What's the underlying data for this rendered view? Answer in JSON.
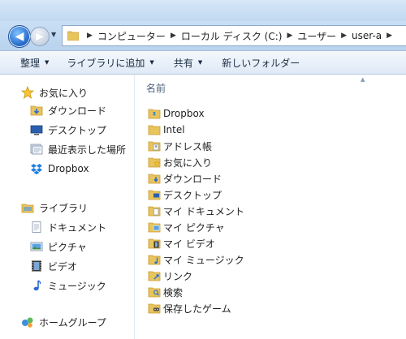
{
  "address": {
    "crumbs": [
      "コンピューター",
      "ローカル ディスク (C:)",
      "ユーザー",
      "user-a"
    ]
  },
  "toolbar": {
    "organize": "整理",
    "include_in_library": "ライブラリに追加",
    "share": "共有",
    "new_folder": "新しいフォルダー"
  },
  "nav": {
    "favorites": {
      "title": "お気に入り",
      "items": [
        "ダウンロード",
        "デスクトップ",
        "最近表示した場所",
        "Dropbox"
      ]
    },
    "libraries": {
      "title": "ライブラリ",
      "items": [
        "ドキュメント",
        "ピクチャ",
        "ビデオ",
        "ミュージック"
      ]
    },
    "homegroup": "ホームグループ"
  },
  "content": {
    "column_name": "名前",
    "files": [
      {
        "name": "Dropbox",
        "icon": "dropbox-folder-icon"
      },
      {
        "name": "Intel",
        "icon": "folder-icon"
      },
      {
        "name": "アドレス帳",
        "icon": "contacts-folder-icon"
      },
      {
        "name": "お気に入り",
        "icon": "favorites-folder-icon"
      },
      {
        "name": "ダウンロード",
        "icon": "downloads-folder-icon"
      },
      {
        "name": "デスクトップ",
        "icon": "desktop-folder-icon"
      },
      {
        "name": "マイ ドキュメント",
        "icon": "documents-folder-icon"
      },
      {
        "name": "マイ ピクチャ",
        "icon": "pictures-folder-icon"
      },
      {
        "name": "マイ ビデオ",
        "icon": "videos-folder-icon"
      },
      {
        "name": "マイ ミュージック",
        "icon": "music-folder-icon"
      },
      {
        "name": "リンク",
        "icon": "links-folder-icon"
      },
      {
        "name": "検索",
        "icon": "searches-folder-icon"
      },
      {
        "name": "保存したゲーム",
        "icon": "saved-games-folder-icon"
      }
    ]
  },
  "colors": {
    "folder": "#e8c45c",
    "folder_dark": "#c99a2e",
    "accent": "#1d62c5"
  }
}
